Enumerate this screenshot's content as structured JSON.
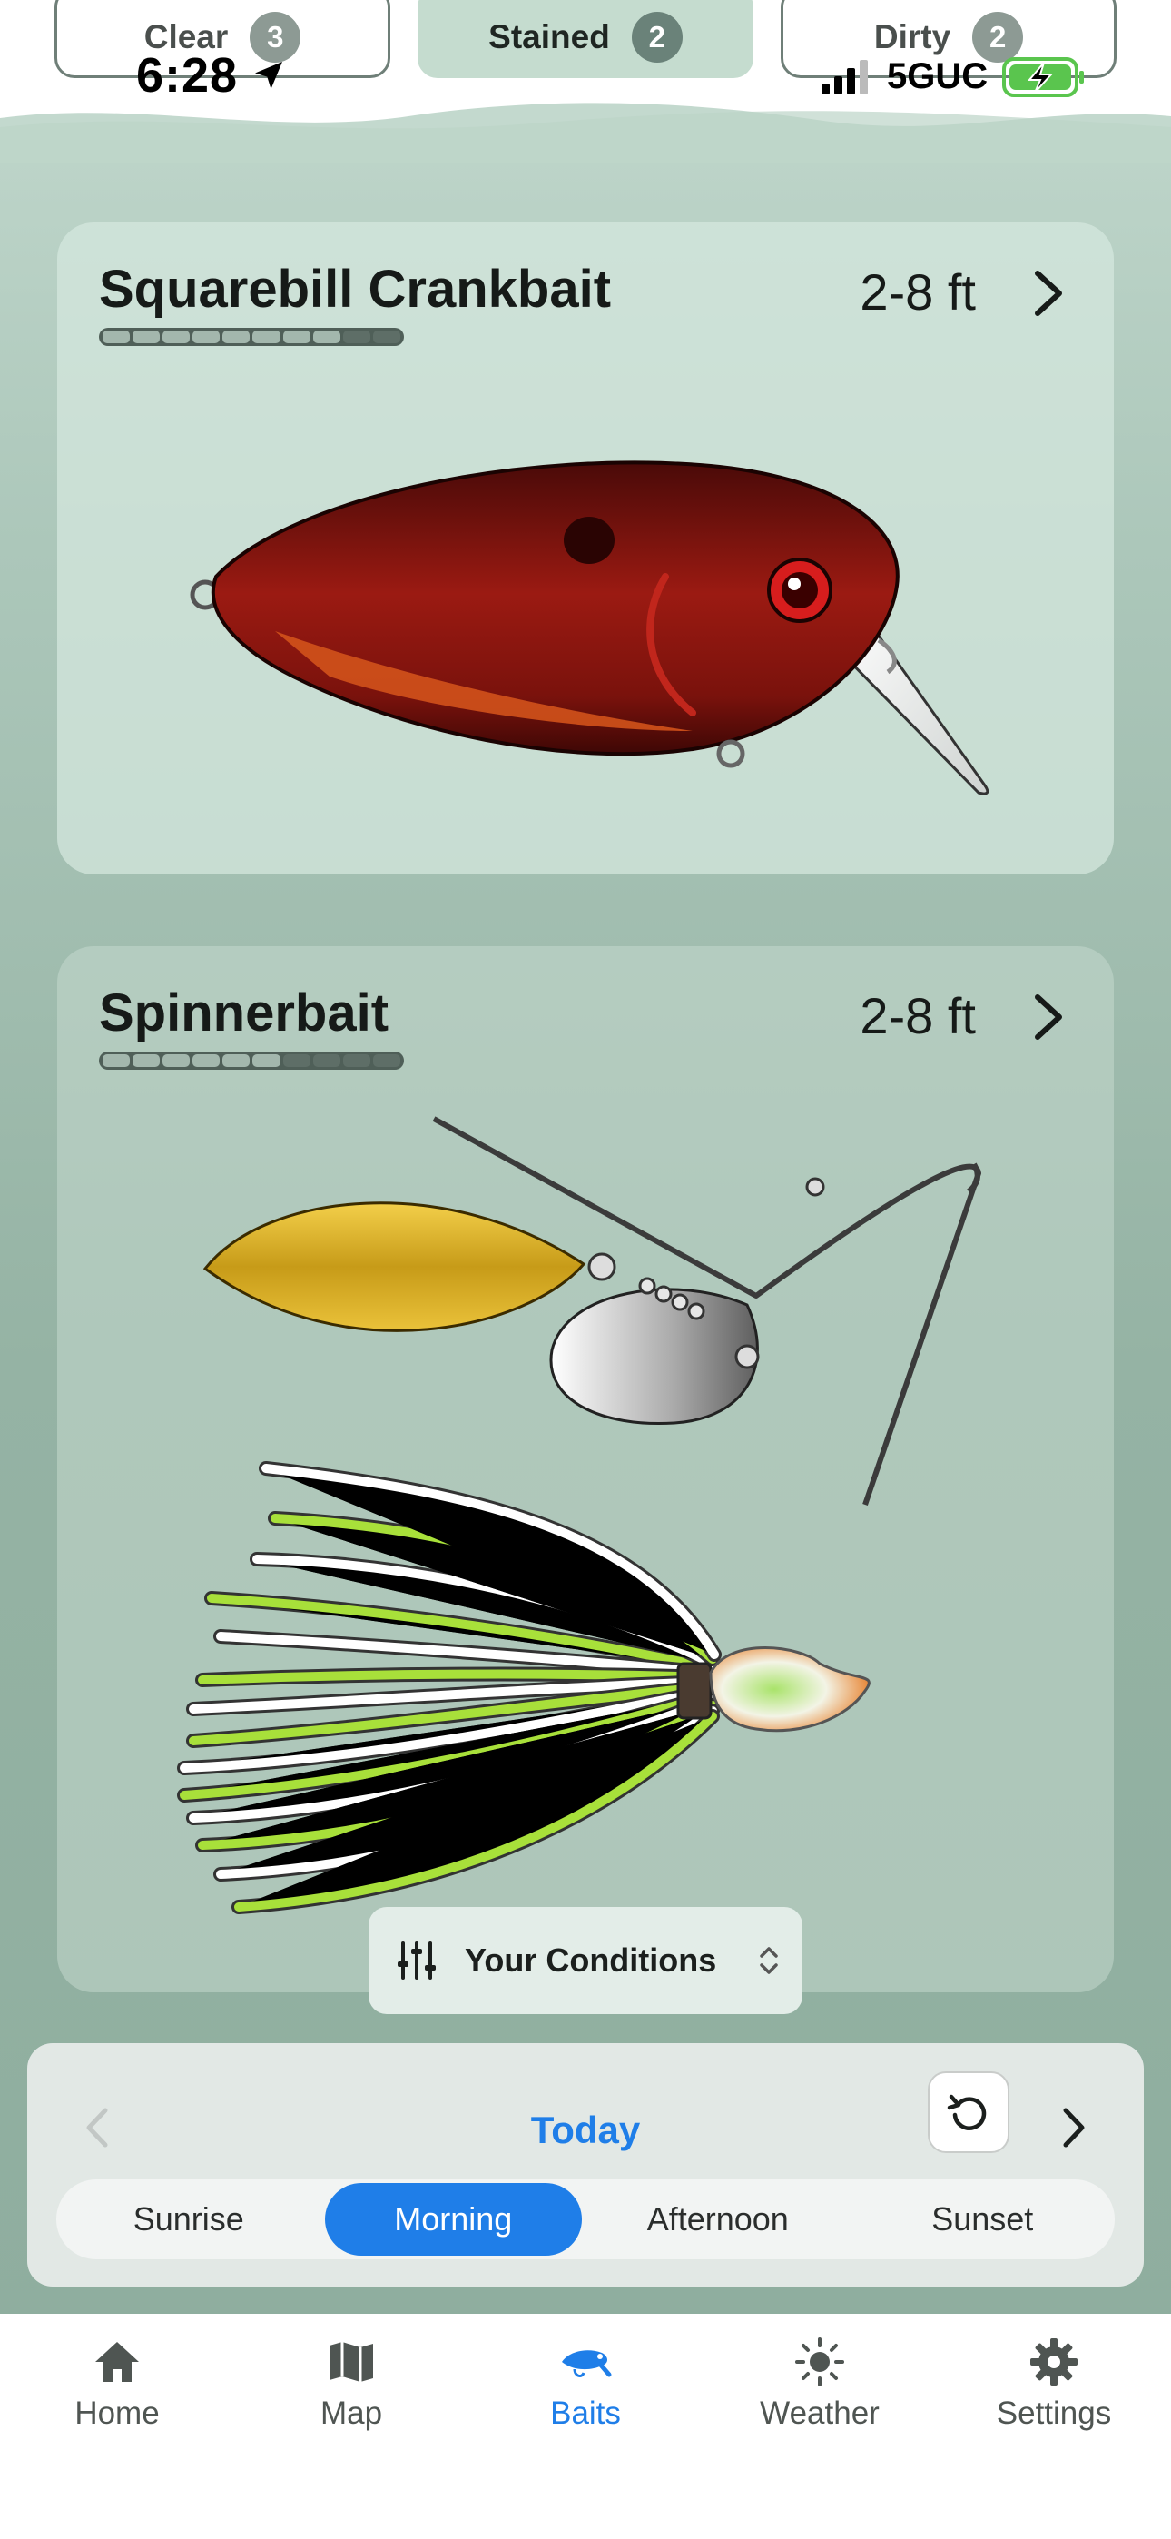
{
  "status_bar": {
    "time": "6:28",
    "network": "5GUC"
  },
  "water_filters": [
    {
      "label": "Clear",
      "count": "3",
      "selected": false
    },
    {
      "label": "Stained",
      "count": "2",
      "selected": true
    },
    {
      "label": "Dirty",
      "count": "2",
      "selected": false
    }
  ],
  "baits": [
    {
      "name": "Squarebill Crankbait",
      "depth": "2-8 ft",
      "depth_level": 0.8
    },
    {
      "name": "Spinnerbait",
      "depth": "2-8 ft",
      "depth_level": 0.65
    }
  ],
  "conditions_button": {
    "label": "Your Conditions"
  },
  "day_selector": {
    "label": "Today"
  },
  "time_of_day": {
    "options": [
      "Sunrise",
      "Morning",
      "Afternoon",
      "Sunset"
    ],
    "selected": "Morning"
  },
  "tab_bar": {
    "tabs": [
      {
        "label": "Home",
        "icon": "home-icon"
      },
      {
        "label": "Map",
        "icon": "map-icon"
      },
      {
        "label": "Baits",
        "icon": "baits-icon"
      },
      {
        "label": "Weather",
        "icon": "weather-icon"
      },
      {
        "label": "Settings",
        "icon": "gear-icon"
      }
    ],
    "active": "Baits"
  },
  "colors": {
    "accent": "#1f7ee8",
    "crankbait_body": "#8c1410",
    "blade_gold": "#e2b52c",
    "skirt_chartreuse": "#a8e03a"
  }
}
